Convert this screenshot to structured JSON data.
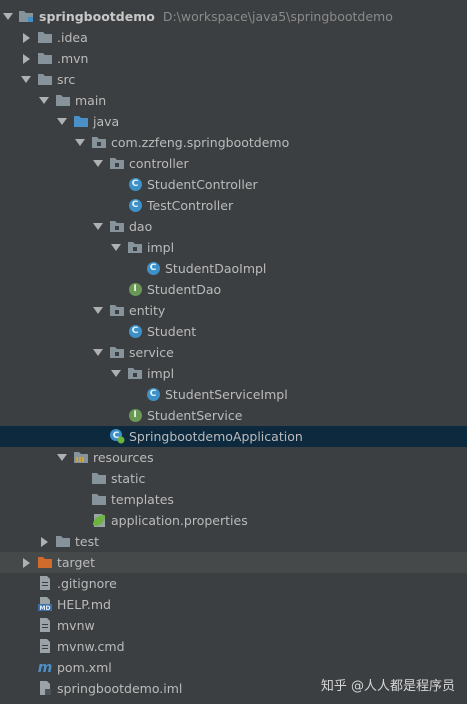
{
  "root": {
    "label": "springbootdemo",
    "path": "D:\\workspace\\java5\\springbootdemo"
  },
  "tree": {
    "idea": ".idea",
    "mvn": ".mvn",
    "src": "src",
    "main": "main",
    "java": "java",
    "package": "com.zzfeng.springbootdemo",
    "controller": "controller",
    "student_controller": "StudentController",
    "test_controller": "TestController",
    "dao": "dao",
    "dao_impl": "impl",
    "student_dao_impl": "StudentDaoImpl",
    "student_dao": "StudentDao",
    "entity": "entity",
    "student": "Student",
    "service": "service",
    "service_impl": "impl",
    "student_service_impl": "StudentServiceImpl",
    "student_service": "StudentService",
    "application_class": "SpringbootdemoApplication",
    "resources": "resources",
    "static": "static",
    "templates": "templates",
    "application_properties": "application.properties",
    "test": "test",
    "target": "target",
    "gitignore": ".gitignore",
    "help": "HELP.md",
    "mvnw": "mvnw",
    "mvnw_cmd": "mvnw.cmd",
    "pom": "pom.xml",
    "iml": "springbootdemo.iml"
  },
  "icon_letters": {
    "class": "C",
    "interface": "I",
    "md": "MD",
    "maven": "m"
  },
  "watermark": "知乎 @人人都是程序员",
  "colors": {
    "background": "#3c3f41",
    "selection": "#0d293e",
    "text": "#bbbbbb",
    "class_icon": "#3d91c8",
    "interface_icon": "#6a9955",
    "folder": "#87939a",
    "target_folder": "#d06b2e"
  }
}
